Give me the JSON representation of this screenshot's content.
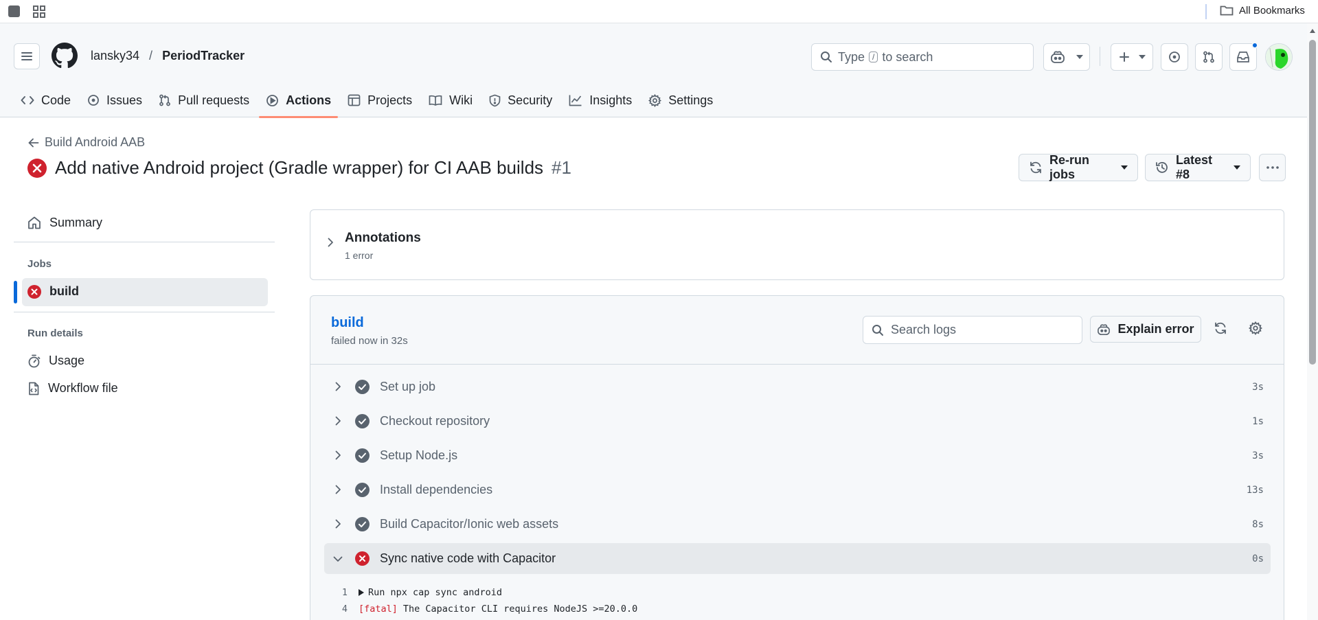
{
  "browser": {
    "bookmarks_label": "All Bookmarks"
  },
  "header": {
    "owner": "lansky34",
    "separator": "/",
    "repo": "PeriodTracker",
    "search_prefix": "Type",
    "search_key": "/",
    "search_suffix": "to search"
  },
  "tabs": [
    {
      "label": "Code",
      "icon": "code-icon"
    },
    {
      "label": "Issues",
      "icon": "issue-opened-icon"
    },
    {
      "label": "Pull requests",
      "icon": "git-pull-request-icon"
    },
    {
      "label": "Actions",
      "icon": "play-icon",
      "active": true
    },
    {
      "label": "Projects",
      "icon": "table-icon"
    },
    {
      "label": "Wiki",
      "icon": "book-icon"
    },
    {
      "label": "Security",
      "icon": "shield-icon"
    },
    {
      "label": "Insights",
      "icon": "graph-icon"
    },
    {
      "label": "Settings",
      "icon": "gear-icon"
    }
  ],
  "run": {
    "back_label": "Build Android AAB",
    "title": "Add native Android project (Gradle wrapper) for CI AAB builds",
    "number": "#1",
    "rerun_label": "Re-run jobs",
    "latest_label": "Latest #8"
  },
  "sidebar": {
    "summary": "Summary",
    "jobs_heading": "Jobs",
    "job": "build",
    "run_details_heading": "Run details",
    "usage": "Usage",
    "workflow_file": "Workflow file"
  },
  "annotations": {
    "title": "Annotations",
    "count": "1 error"
  },
  "job": {
    "name": "build",
    "status": "failed now in 32s",
    "search_placeholder": "Search logs",
    "explain_label": "Explain error",
    "steps": [
      {
        "label": "Set up job",
        "duration": "3s",
        "status": "success"
      },
      {
        "label": "Checkout repository",
        "duration": "1s",
        "status": "success"
      },
      {
        "label": "Setup Node.js",
        "duration": "3s",
        "status": "success"
      },
      {
        "label": "Install dependencies",
        "duration": "13s",
        "status": "success"
      },
      {
        "label": "Build Capacitor/Ionic web assets",
        "duration": "8s",
        "status": "success"
      },
      {
        "label": "Sync native code with Capacitor",
        "duration": "0s",
        "status": "failure",
        "expanded": true
      }
    ],
    "log": [
      {
        "line": "1",
        "text": "Run npx cap sync android"
      },
      {
        "line": "4",
        "prefix": "[fatal]",
        "text": "The Capacitor CLI requires NodeJS >=20.0.0"
      }
    ]
  },
  "colors": {
    "accent": "#0969da",
    "danger": "#cf222e",
    "tab_underline": "#fd8c73",
    "success_gray": "#59636e"
  }
}
